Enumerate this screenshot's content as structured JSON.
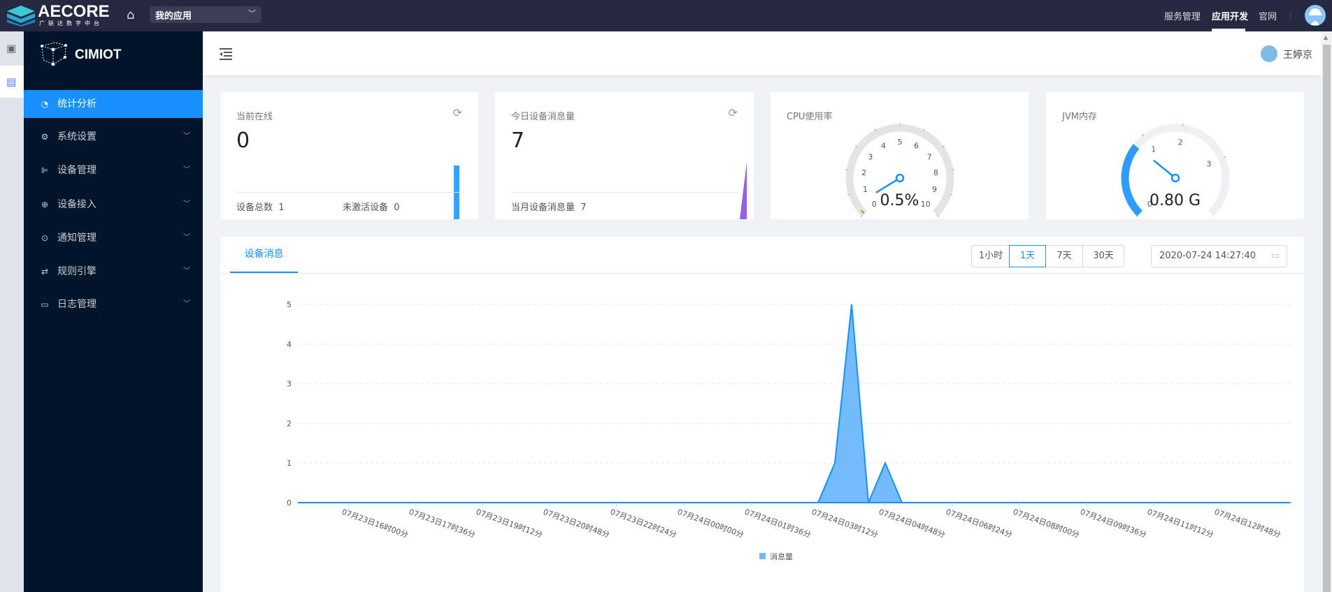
{
  "topbar": {
    "logo": "AECORE",
    "logo_sub": "广联达数字中台",
    "app_select": "我的应用",
    "nav": [
      "服务管理",
      "应用开发",
      "官网"
    ],
    "active_nav": "应用开发"
  },
  "sidebar": {
    "brand": "CIMIOT",
    "items": [
      {
        "label": "统计分析",
        "icon": "dashboard-icon",
        "active": true
      },
      {
        "label": "系统设置",
        "icon": "gear-icon"
      },
      {
        "label": "设备管理",
        "icon": "device-icon"
      },
      {
        "label": "设备接入",
        "icon": "login-icon"
      },
      {
        "label": "通知管理",
        "icon": "message-icon"
      },
      {
        "label": "规则引擎",
        "icon": "retweet-icon"
      },
      {
        "label": "日志管理",
        "icon": "calendar-icon"
      }
    ]
  },
  "header": {
    "user": "王婷京"
  },
  "cards": {
    "online": {
      "title": "当前在线",
      "value": "0",
      "total_label": "设备总数",
      "total": "1",
      "inactive_label": "未激活设备",
      "inactive": "0"
    },
    "messages": {
      "title": "今日设备消息量",
      "value": "7",
      "month_label": "当月设备消息量",
      "month": "7"
    },
    "cpu": {
      "title": "CPU使用率",
      "value": 0.5,
      "display": "0.5%",
      "max": 10,
      "labels": [
        "0",
        "1",
        "2",
        "3",
        "4",
        "5",
        "6",
        "7",
        "8",
        "9",
        "10"
      ]
    },
    "jvm": {
      "title": "JVM内存",
      "value": 0.8,
      "display": "0.80 G",
      "labels": [
        "0",
        "1",
        "2",
        "3"
      ]
    }
  },
  "panel": {
    "tab": "设备消息",
    "ranges": [
      "1小时",
      "1天",
      "7天",
      "30天"
    ],
    "active_range": "1天",
    "date": "2020-07-24 14:27:40"
  },
  "colors": {
    "primary": "#1890ff",
    "area": "#74bbfb",
    "sidebar": "#001529",
    "topbar": "#242840",
    "purple": "#975fe4"
  },
  "chart_data": {
    "type": "area",
    "ylim": [
      0,
      5
    ],
    "yticks": [
      "0",
      "1",
      "2",
      "3",
      "4",
      "5"
    ],
    "xticks": [
      "07月23日16时00分",
      "07月23日17时36分",
      "07月23日19时12分",
      "07月23日20时48分",
      "07月23日22时24分",
      "07月24日00时00分",
      "07月24日01时36分",
      "07月24日03时12分",
      "07月24日04时48分",
      "07月24日06时24分",
      "07月24日08时00分",
      "07月24日09时36分",
      "07月24日11时12分",
      "07月24日12时48分"
    ],
    "series": [
      {
        "name": "消息量",
        "points": [
          [
            "2020-07-23 14:48",
            0
          ],
          [
            "2020-07-23 15:12",
            0
          ],
          [
            "2020-07-23 15:36",
            0
          ],
          [
            "2020-07-23 16:00",
            0
          ],
          [
            "2020-07-23 16:24",
            0
          ],
          [
            "2020-07-23 16:48",
            0
          ],
          [
            "2020-07-23 17:12",
            0
          ],
          [
            "2020-07-23 17:36",
            0
          ],
          [
            "2020-07-23 18:00",
            0
          ],
          [
            "2020-07-23 18:24",
            0
          ],
          [
            "2020-07-23 18:48",
            0
          ],
          [
            "2020-07-23 19:12",
            0
          ],
          [
            "2020-07-23 19:36",
            0
          ],
          [
            "2020-07-23 20:00",
            0
          ],
          [
            "2020-07-23 20:24",
            0
          ],
          [
            "2020-07-23 20:48",
            0
          ],
          [
            "2020-07-23 21:12",
            0
          ],
          [
            "2020-07-23 21:36",
            0
          ],
          [
            "2020-07-23 22:00",
            0
          ],
          [
            "2020-07-23 22:24",
            0
          ],
          [
            "2020-07-23 22:48",
            0
          ],
          [
            "2020-07-23 23:12",
            0
          ],
          [
            "2020-07-23 23:36",
            0
          ],
          [
            "2020-07-24 00:00",
            0
          ],
          [
            "2020-07-24 00:24",
            0
          ],
          [
            "2020-07-24 00:48",
            0
          ],
          [
            "2020-07-24 01:12",
            0
          ],
          [
            "2020-07-24 01:36",
            0
          ],
          [
            "2020-07-24 02:00",
            0
          ],
          [
            "2020-07-24 02:24",
            0
          ],
          [
            "2020-07-24 02:48",
            0
          ],
          [
            "2020-07-24 03:12",
            0
          ],
          [
            "2020-07-24 03:36",
            1
          ],
          [
            "2020-07-24 04:00",
            5
          ],
          [
            "2020-07-24 04:24",
            0
          ],
          [
            "2020-07-24 04:48",
            1
          ],
          [
            "2020-07-24 05:12",
            0
          ],
          [
            "2020-07-24 05:36",
            0
          ],
          [
            "2020-07-24 06:00",
            0
          ],
          [
            "2020-07-24 06:24",
            0
          ],
          [
            "2020-07-24 06:48",
            0
          ],
          [
            "2020-07-24 07:12",
            0
          ],
          [
            "2020-07-24 07:36",
            0
          ],
          [
            "2020-07-24 08:00",
            0
          ],
          [
            "2020-07-24 08:24",
            0
          ],
          [
            "2020-07-24 08:48",
            0
          ],
          [
            "2020-07-24 09:12",
            0
          ],
          [
            "2020-07-24 09:36",
            0
          ],
          [
            "2020-07-24 10:00",
            0
          ],
          [
            "2020-07-24 10:24",
            0
          ],
          [
            "2020-07-24 10:48",
            0
          ],
          [
            "2020-07-24 11:12",
            0
          ],
          [
            "2020-07-24 11:36",
            0
          ],
          [
            "2020-07-24 12:00",
            0
          ],
          [
            "2020-07-24 12:24",
            0
          ],
          [
            "2020-07-24 12:48",
            0
          ],
          [
            "2020-07-24 13:12",
            0
          ],
          [
            "2020-07-24 13:36",
            0
          ],
          [
            "2020-07-24 14:00",
            0
          ],
          [
            "2020-07-24 14:24",
            0
          ]
        ]
      }
    ],
    "legend": "bottom",
    "grid": "dashed horizontal"
  }
}
